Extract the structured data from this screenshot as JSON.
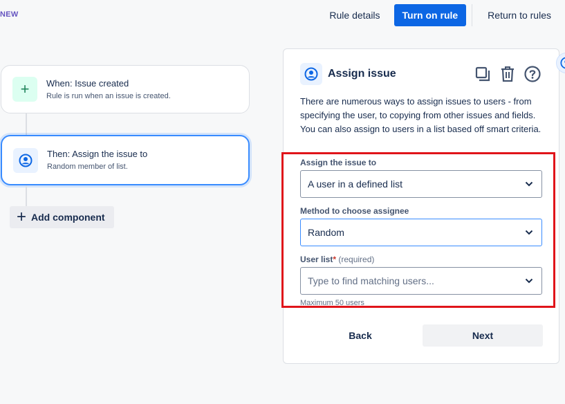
{
  "header": {
    "new_badge": "NEW",
    "rule_details": "Rule details",
    "turn_on_rule": "Turn on rule",
    "return_to_rules": "Return to rules"
  },
  "flow": {
    "trigger": {
      "title": "When: Issue created",
      "subtitle": "Rule is run when an issue is created.",
      "icon": "plus-icon"
    },
    "action": {
      "title": "Then: Assign the issue to",
      "subtitle": "Random member of list.",
      "icon": "user-avatar-icon"
    },
    "add_component": "Add component"
  },
  "panel": {
    "title": "Assign issue",
    "description": "There are numerous ways to assign issues to users - from specifying the user, to copying from other issues and fields. You can also assign to users in a list based off smart criteria.",
    "fields": {
      "assign_to": {
        "label": "Assign the issue to",
        "value": "A user in a defined list"
      },
      "method": {
        "label": "Method to choose assignee",
        "value": "Random"
      },
      "user_list": {
        "label": "User list",
        "required_marker": "*",
        "required_text": "(required)",
        "placeholder": "Type to find matching users...",
        "help": "Maximum 50 users"
      }
    },
    "buttons": {
      "back": "Back",
      "next": "Next"
    }
  },
  "colors": {
    "primary": "#0c66e4",
    "highlight": "#e0141a",
    "selected_border": "#388bff",
    "trigger_icon_bg": "#dcfff1"
  }
}
